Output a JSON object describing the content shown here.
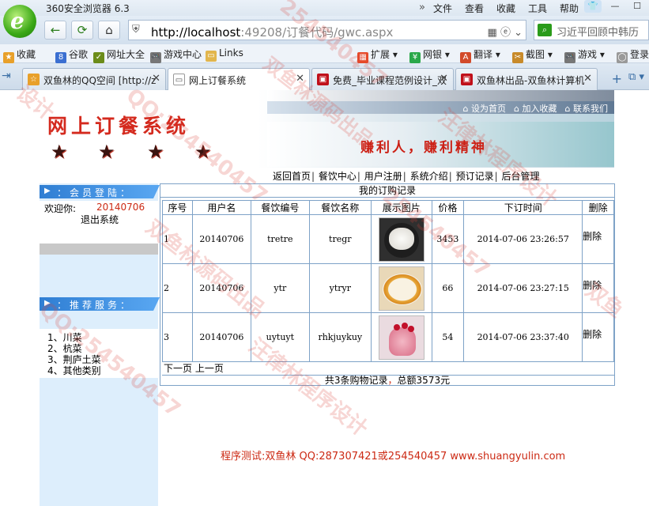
{
  "browser": {
    "title": "360安全浏览器 6.3",
    "menus": [
      "文件",
      "查看",
      "收藏",
      "工具",
      "帮助"
    ],
    "url_host": "http://localhost",
    "url_rest": ":49208/订餐代码/gwc.aspx",
    "search_text": "习近平回顾中韩历",
    "favorites": [
      "收藏",
      "谷歌",
      "网址大全",
      "游戏中心",
      "Links"
    ],
    "extensions": [
      "扩展",
      "网银",
      "翻译",
      "截图",
      "游戏",
      "登录"
    ],
    "tabs": [
      {
        "label": "双鱼林的QQ空间 [http://z",
        "active": false
      },
      {
        "label": "网上订餐系统",
        "active": true
      },
      {
        "label": "免费_毕业课程范例设计_双",
        "active": false
      },
      {
        "label": "双鱼林出品-双鱼林计算机",
        "active": false
      }
    ]
  },
  "banner": {
    "title": "网上订餐系统",
    "slogan": "赚利人，赚利精神",
    "top_links": [
      "设为首页",
      "加入收藏",
      "联系我们"
    ]
  },
  "mainnav": [
    "返回首页",
    "餐饮中心",
    "用户注册",
    "系统介绍",
    "预订记录",
    "后台管理"
  ],
  "sidebar": {
    "member_title": "：会员登陆：",
    "welcome_label": "欢迎你:",
    "welcome_user": "20140706",
    "logout": "退出系统",
    "recommend_title": "：推荐服务：",
    "recommend_items": [
      "1、川菜",
      "2、杭菜",
      "3、荆庐土菜",
      "4、其他类别"
    ]
  },
  "orders": {
    "caption": "我的订购记录",
    "columns": [
      "序号",
      "用户名",
      "餐饮编号",
      "餐饮名称",
      "展示图片",
      "价格",
      "下订时间",
      "删除"
    ],
    "rows": [
      {
        "idx": "1",
        "user": "20140706",
        "code": "tretre",
        "name": "tregr",
        "price": "3453",
        "time": "2014-07-06 23:26:57",
        "delete": "删除"
      },
      {
        "idx": "2",
        "user": "20140706",
        "code": "ytr",
        "name": "ytryr",
        "price": "66",
        "time": "2014-07-06 23:27:15",
        "delete": "删除"
      },
      {
        "idx": "3",
        "user": "20140706",
        "code": "uytuyt",
        "name": "rhkjuykuy",
        "price": "54",
        "time": "2014-07-06 23:37:40",
        "delete": "删除"
      }
    ],
    "pager_next": "下一页",
    "pager_prev": "上一页",
    "total_prefix": "共3条购物记录",
    "total_sep": "，",
    "total_amount": "总额3573元"
  },
  "footer": "程序测试:双鱼林 QQ:287307421或254540457 www.shuangyulin.com",
  "watermarks": [
    "254540457",
    "双鱼林源码出品",
    "汪律林程序设计",
    "QQ:254540457",
    "设计",
    "双鱼"
  ]
}
